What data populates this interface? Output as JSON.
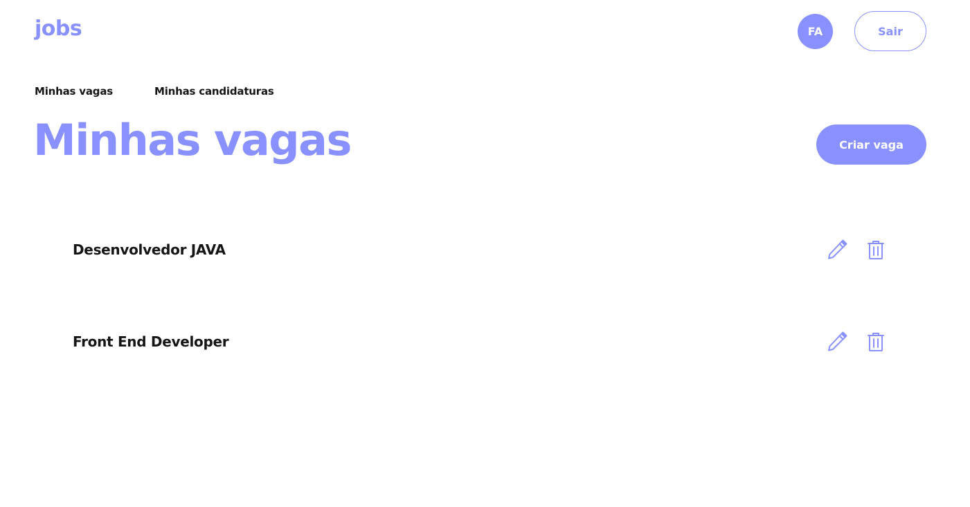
{
  "header": {
    "logo": "jobs",
    "avatar_initials": "FA",
    "logout_label": "Sair"
  },
  "nav": {
    "items": [
      {
        "label": "Minhas vagas"
      },
      {
        "label": "Minhas candidaturas"
      }
    ]
  },
  "main": {
    "title": "Minhas vagas",
    "create_label": "Criar vaga",
    "jobs": [
      {
        "title": "Desenvolvedor JAVA",
        "edit_icon": "pencil-icon",
        "delete_icon": "trash-icon"
      },
      {
        "title": "Front End Developer",
        "edit_icon": "pencil-icon",
        "delete_icon": "trash-icon"
      }
    ]
  },
  "colors": {
    "accent": "#8891ff",
    "text": "#151515",
    "background": "#ffffff"
  }
}
